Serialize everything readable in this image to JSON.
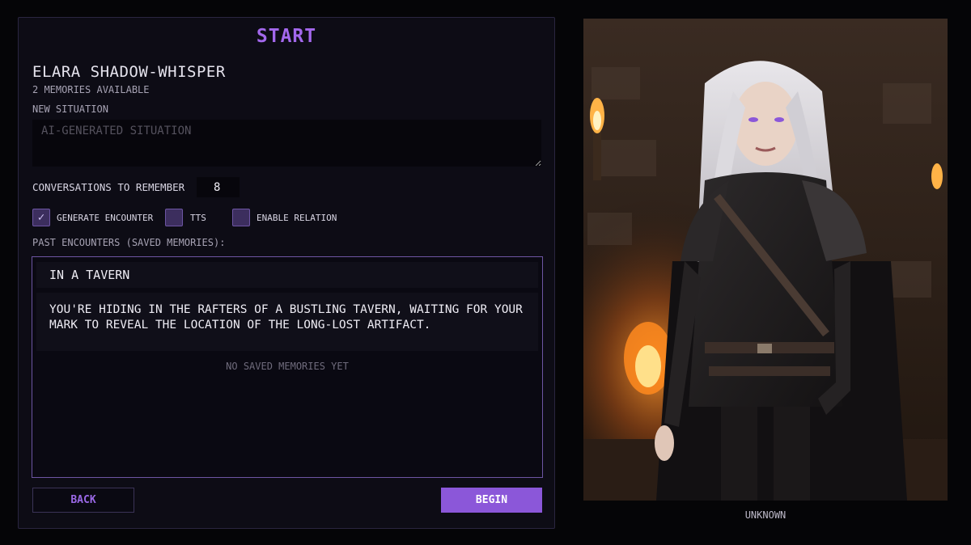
{
  "page": {
    "title": "START"
  },
  "character": {
    "name": "ELARA SHADOW-WHISPER",
    "memories": "2 MEMORIES AVAILABLE",
    "portrait_caption": "UNKNOWN"
  },
  "situation": {
    "label": "NEW SITUATION",
    "placeholder": "AI-GENERATED SITUATION",
    "value": ""
  },
  "conversations": {
    "label": "CONVERSATIONS TO REMEMBER",
    "value": "8"
  },
  "options": [
    {
      "label": "GENERATE ENCOUNTER",
      "checked": true
    },
    {
      "label": "TTS",
      "checked": false
    },
    {
      "label": "ENABLE RELATION",
      "checked": false
    }
  ],
  "past_encounters": {
    "label": "PAST ENCOUNTERS (SAVED MEMORIES):",
    "encounter_title": "IN A TAVERN",
    "encounter_text": "YOU'RE HIDING IN THE RAFTERS OF A BUSTLING TAVERN, WAITING FOR YOUR MARK TO REVEAL THE LOCATION OF THE LONG-LOST ARTIFACT.",
    "empty_note": "NO SAVED MEMORIES YET"
  },
  "buttons": {
    "back": "BACK",
    "begin": "BEGIN"
  },
  "colors": {
    "accent": "#8b57d9",
    "title": "#a368ec",
    "panel_bg": "#0d0c15",
    "page_bg": "#050507"
  }
}
